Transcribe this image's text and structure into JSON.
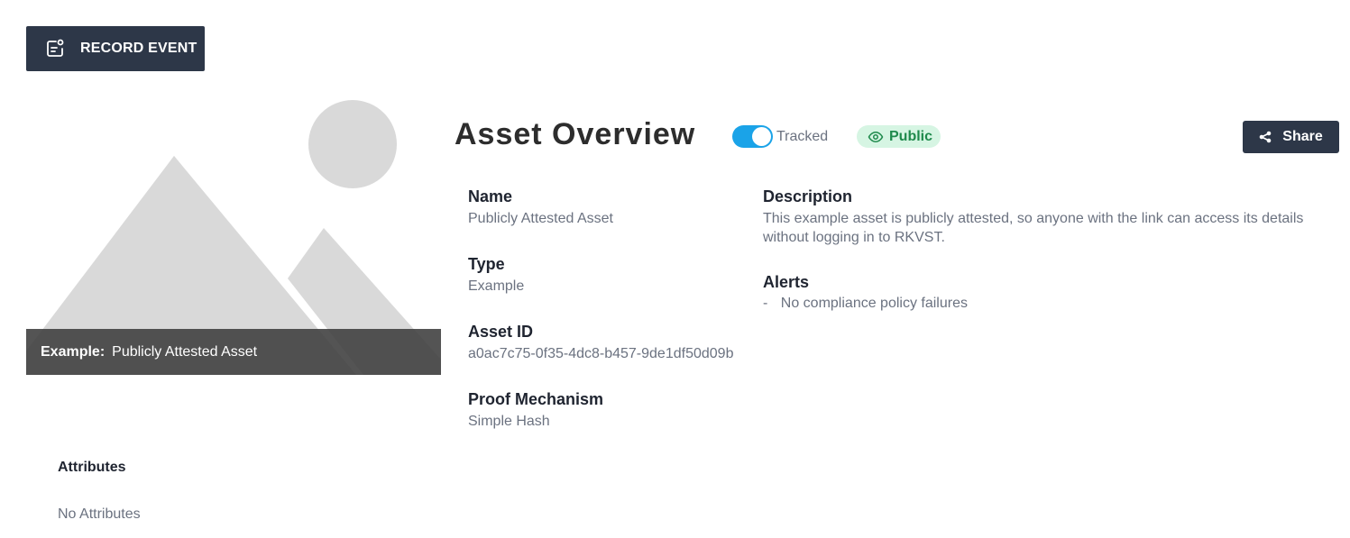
{
  "toolbar": {
    "record_event_label": "RECORD EVENT"
  },
  "hero": {
    "caption_key": "Example:",
    "caption_value": "Publicly Attested Asset"
  },
  "header": {
    "title": "Asset Overview",
    "tracked_label": "Tracked",
    "tracked_on": true,
    "public_label": "Public",
    "share_label": "Share"
  },
  "fields": {
    "name": {
      "label": "Name",
      "value": "Publicly Attested Asset"
    },
    "type": {
      "label": "Type",
      "value": "Example"
    },
    "asset_id": {
      "label": "Asset ID",
      "value": "a0ac7c75-0f35-4dc8-b457-9de1df50d09b"
    },
    "proof": {
      "label": "Proof Mechanism",
      "value": "Simple Hash"
    },
    "description": {
      "label": "Description",
      "value": "This example asset is publicly attested, so anyone with the link can access its details without logging in to RKVST."
    },
    "alerts": {
      "label": "Alerts",
      "items": [
        "No compliance policy failures"
      ]
    }
  },
  "attributes": {
    "title": "Attributes",
    "empty_text": "No Attributes"
  },
  "colors": {
    "primary_dark": "#2d3748",
    "toggle_blue": "#1aa3e8",
    "public_green": "#1f8a4c",
    "public_bg": "#d6f5e3"
  },
  "icons": {
    "record_event": "clipboard-event-icon",
    "public": "eye-icon",
    "share": "share-icon"
  }
}
